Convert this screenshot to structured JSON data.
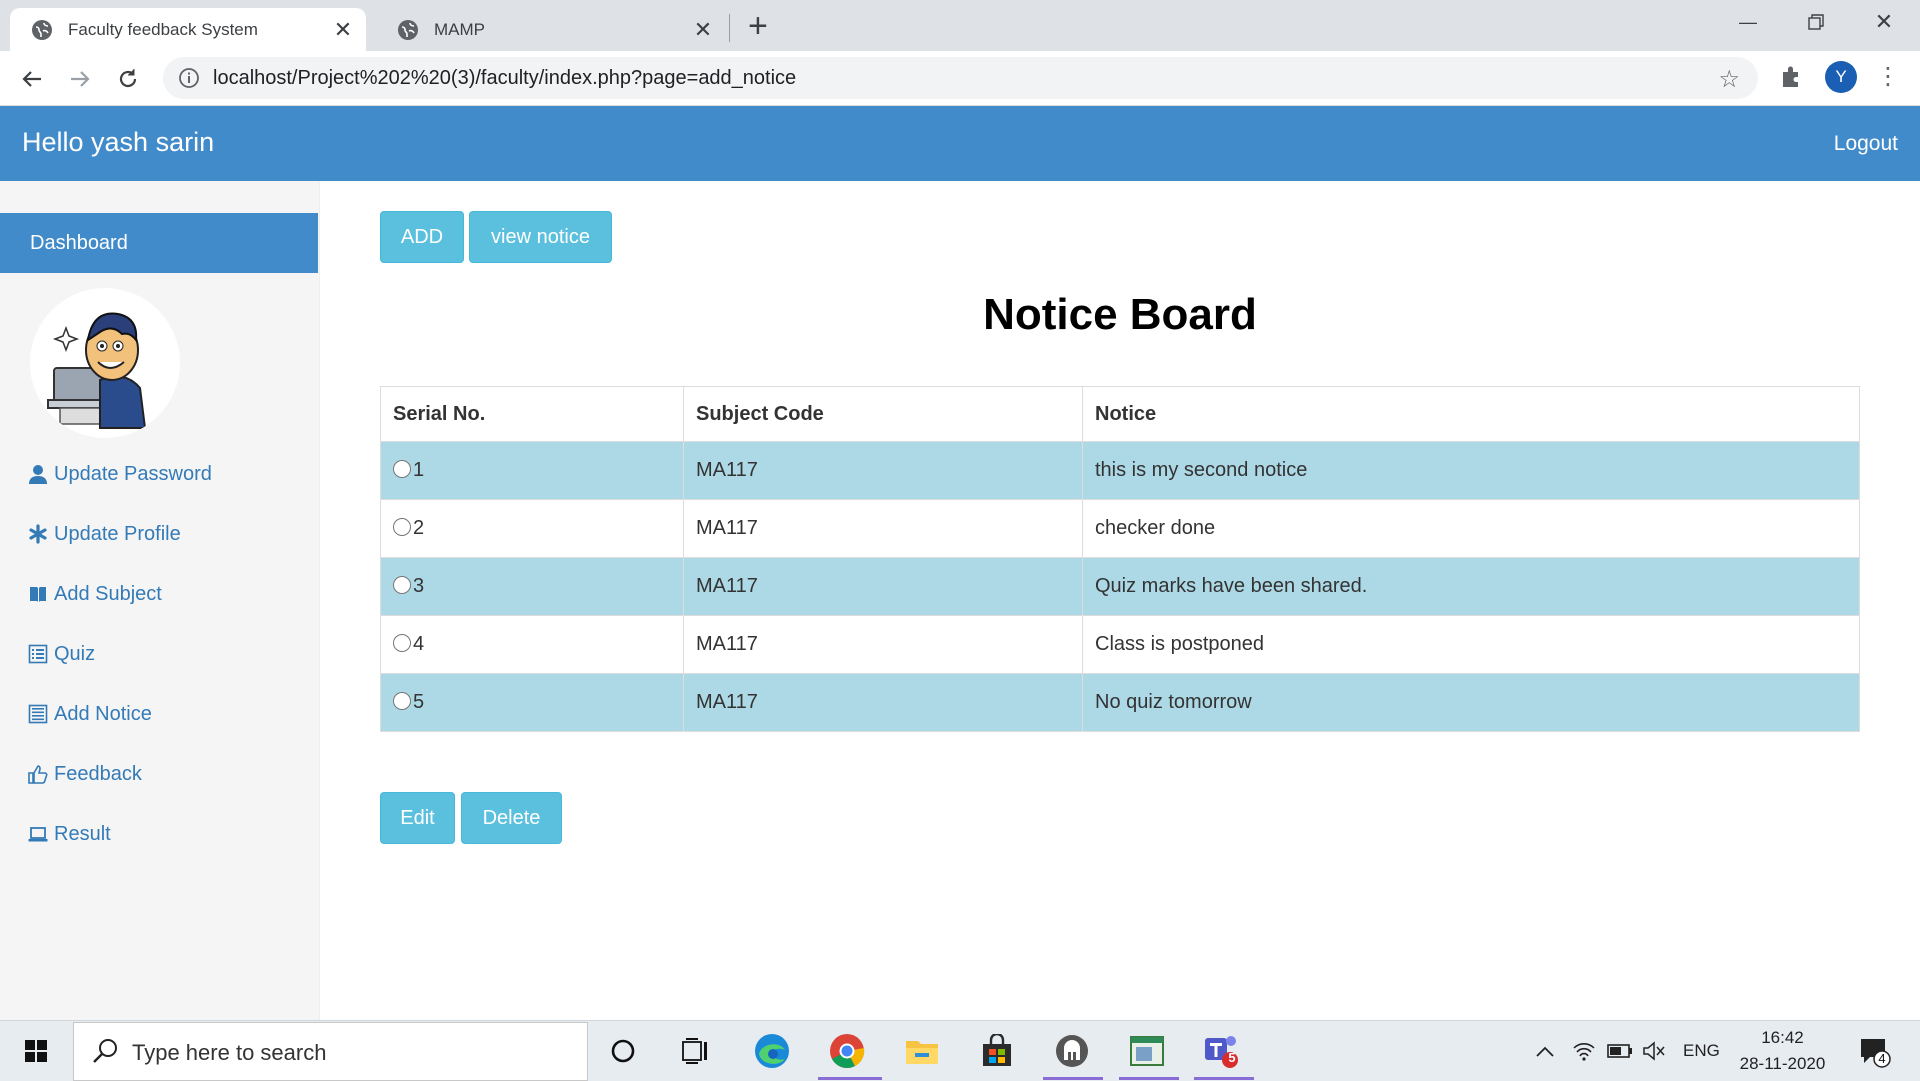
{
  "browser": {
    "tabs": [
      {
        "title": "Faculty feedback System",
        "active": true
      },
      {
        "title": "MAMP",
        "active": false
      }
    ],
    "url": "localhost/Project%202%20(3)/faculty/index.php?page=add_notice",
    "profile_initial": "Y"
  },
  "header": {
    "greeting": "Hello yash sarin",
    "logout_label": "Logout",
    "color": "#428bca"
  },
  "sidebar": {
    "dashboard_label": "Dashboard",
    "items": [
      {
        "label": "Update Password",
        "icon": "user-icon"
      },
      {
        "label": "Update Profile",
        "icon": "asterisk-icon"
      },
      {
        "label": "Add Subject",
        "icon": "book-icon"
      },
      {
        "label": "Quiz",
        "icon": "list-alt-icon"
      },
      {
        "label": "Add Notice",
        "icon": "list-icon"
      },
      {
        "label": "Feedback",
        "icon": "thumbs-up-icon"
      },
      {
        "label": "Result",
        "icon": "laptop-icon"
      }
    ]
  },
  "main": {
    "add_label": "ADD",
    "view_label": "view notice",
    "title": "Notice Board",
    "columns": [
      "Serial No.",
      "Subject Code",
      "Notice"
    ],
    "rows": [
      {
        "serial": "1",
        "subject": "MA117",
        "notice": "this is my second notice"
      },
      {
        "serial": "2",
        "subject": "MA117",
        "notice": "checker done"
      },
      {
        "serial": "3",
        "subject": "MA117",
        "notice": "Quiz marks have been shared."
      },
      {
        "serial": "4",
        "subject": "MA117",
        "notice": "Class is postponed"
      },
      {
        "serial": "5",
        "subject": "MA117",
        "notice": "No quiz tomorrow"
      }
    ],
    "edit_label": "Edit",
    "delete_label": "Delete",
    "highlight_color": "#add8e6",
    "button_color": "#5bc0de"
  },
  "taskbar": {
    "search_placeholder": "Type here to search",
    "language": "ENG",
    "time": "16:42",
    "date": "28-11-2020",
    "notification_count": "4",
    "teams_badge": "5"
  }
}
